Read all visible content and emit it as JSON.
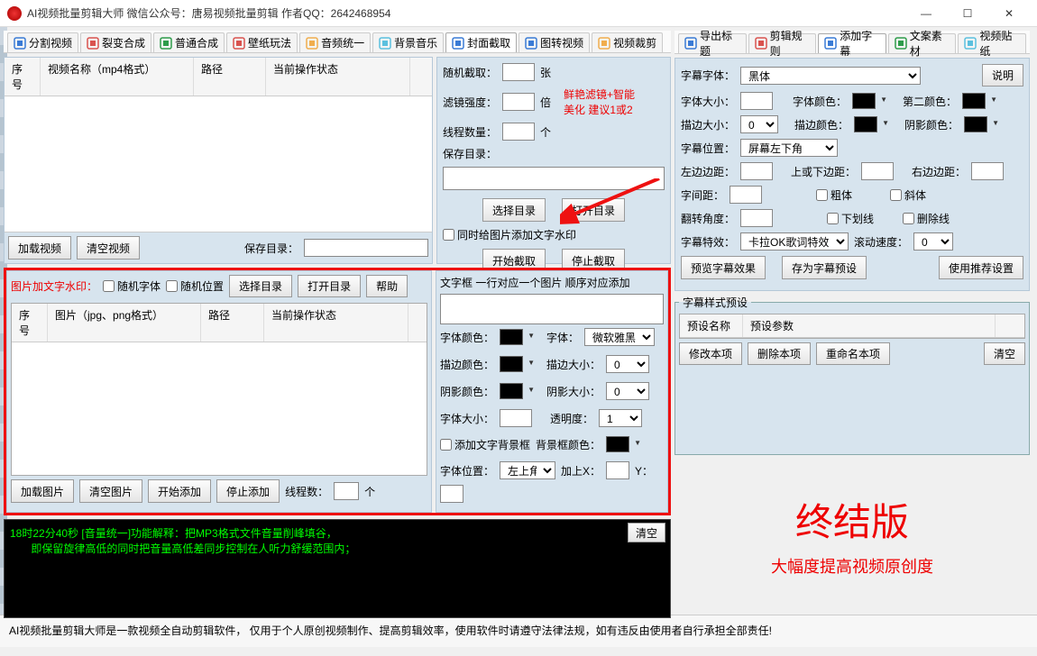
{
  "window": {
    "title": "AI视频批量剪辑大师    微信公众号：唐易视频批量剪辑      作者QQ：2642468954",
    "min": "—",
    "max": "☐",
    "close": "✕"
  },
  "tabs_left": [
    {
      "icon": "#3a7bd5",
      "label": "分割视频"
    },
    {
      "icon": "#d9534f",
      "label": "裂变合成"
    },
    {
      "icon": "#2e9c4b",
      "label": "普通合成"
    },
    {
      "icon": "#d9534f",
      "label": "壁纸玩法"
    },
    {
      "icon": "#f0ad4e",
      "label": "音频统一"
    },
    {
      "icon": "#5bc0de",
      "label": "背景音乐"
    },
    {
      "icon": "#3a7bd5",
      "label": "封面截取",
      "active": true
    },
    {
      "icon": "#3a7bd5",
      "label": "图转视频"
    },
    {
      "icon": "#f0ad4e",
      "label": "视频裁剪"
    }
  ],
  "tabs_right": [
    {
      "icon": "#3a7bd5",
      "label": "导出标题"
    },
    {
      "icon": "#d9534f",
      "label": "剪辑规则"
    },
    {
      "icon": "#3a7bd5",
      "label": "添加字幕",
      "active": true
    },
    {
      "icon": "#2e9c4b",
      "label": "文案素材"
    },
    {
      "icon": "#5bc0de",
      "label": "视频贴纸"
    }
  ],
  "video_grid_cols": [
    "序号",
    "视频名称（mp4格式）",
    "路径",
    "当前操作状态"
  ],
  "btns1": {
    "load": "加载视频",
    "clear": "清空视频",
    "save_dir_lbl": "保存目录：",
    "save_dir": ""
  },
  "cover": {
    "rand": "随机截取：",
    "rand_val": "",
    "zhang": "张",
    "filter": "滤镜强度：",
    "filter_val": "",
    "bei": "倍",
    "hint1": "鲜艳滤镜+智能",
    "hint2": "美化 建议1或2",
    "threads": "线程数量：",
    "threads_val": "",
    "ge": "个",
    "savedir": "保存目录：",
    "savedir_val": "",
    "choose": "选择目录",
    "open": "打开目录",
    "wm_chk": "同时给图片添加文字水印",
    "start": "开始截取",
    "stop": "停止截取"
  },
  "wm": {
    "title": "图片加文字水印：",
    "rand_font": "随机字体",
    "rand_pos": "随机位置",
    "choose": "选择目录",
    "open": "打开目录",
    "help": "帮助",
    "cols": [
      "序号",
      "图片（jpg、png格式）",
      "路径",
      "当前操作状态"
    ],
    "load": "加载图片",
    "clear": "清空图片",
    "start": "开始添加",
    "stop": "停止添加",
    "threads_lbl": "线程数：",
    "threads_val": "",
    "ge": "个",
    "textbox_hint": "文字框 一行对应一个图片 顺序对应添加",
    "font_color": "字体颜色：",
    "font": "字体：",
    "font_val": "微软雅黑",
    "stroke_color": "描边颜色：",
    "stroke_w": "描边大小：",
    "stroke_w_val": "0",
    "shadow_color": "阴影颜色：",
    "shadow_w": "阴影大小：",
    "shadow_w_val": "0",
    "font_size": "字体大小：",
    "font_size_val": "",
    "opacity": "透明度：",
    "opacity_val": "1",
    "bgbox": "添加文字背景框",
    "bgcolor": "背景框颜色：",
    "pos": "字体位置：",
    "pos_val": "左上角",
    "addx": "加上X：",
    "addx_val": "",
    "y": "Y：",
    "y_val": ""
  },
  "log": {
    "clear": "清空",
    "l1": "18时22分40秒 [音量统一]功能解释：把MP3格式文件音量削峰填谷，",
    "l2": "       即保留旋律高低的同时把音量高低差同步控制在人听力舒缓范围内；"
  },
  "sub": {
    "explain": "说明",
    "font_lbl": "字幕字体：",
    "font_val": "黑体",
    "size_lbl": "字体大小：",
    "size_val": "",
    "color_lbl": "字体颜色：",
    "color2_lbl": "第二颜色：",
    "stroke_lbl": "描边大小：",
    "stroke_val": "0",
    "stroke_c": "描边颜色：",
    "shadow_c": "阴影颜色：",
    "pos_lbl": "字幕位置：",
    "pos_val": "屏幕左下角",
    "left_lbl": "左边边距：",
    "left_val": "",
    "top_lbl": "上或下边距：",
    "top_val": "",
    "right_lbl": "右边边距：",
    "right_val": "",
    "sp_lbl": "字间距：",
    "sp_val": "",
    "bold": "粗体",
    "italic": "斜体",
    "rot_lbl": "翻转角度：",
    "rot_val": "",
    "under": "下划线",
    "strike": "删除线",
    "fx_lbl": "字幕特效：",
    "fx_val": "卡拉OK歌词特效",
    "speed_lbl": "滚动速度：",
    "speed_val": "0",
    "preview": "预览字幕效果",
    "save_preset": "存为字幕预设",
    "use_rec": "使用推荐设置",
    "preset_legend": "字幕样式预设",
    "preset_cols": [
      "预设名称",
      "预设参数"
    ],
    "edit": "修改本项",
    "del": "删除本项",
    "rename": "重命名本项",
    "clr": "清空"
  },
  "promo": {
    "big": "终结版",
    "sub": "大幅度提高视频原创度"
  },
  "footer": "AI视频批量剪辑大师是一款视频全自动剪辑软件，  仅用于个人原创视频制作、提高剪辑效率，使用软件时请遵守法律法规，如有违反由使用者自行承担全部责任!"
}
